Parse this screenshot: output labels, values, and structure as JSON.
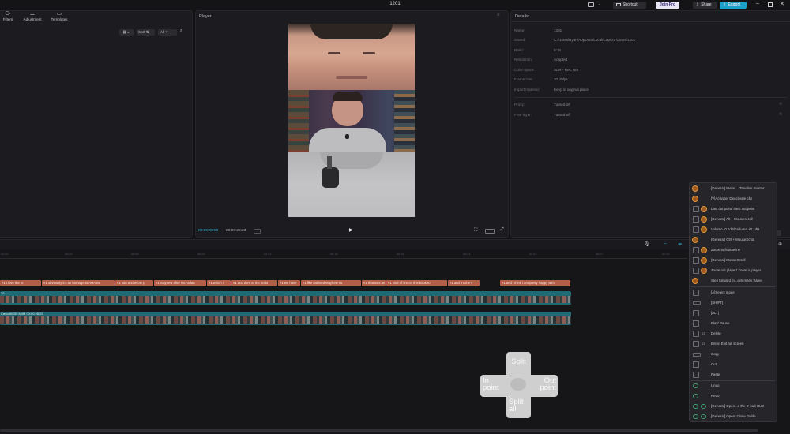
{
  "window": {
    "title": "1201"
  },
  "topbar": {
    "shortcut": "Shortcut",
    "join_pro": "Join Pro",
    "share": "Share",
    "export": "Export"
  },
  "media_tabs": [
    {
      "label": "Filters",
      "icon": "filters-icon"
    },
    {
      "label": "Adjustment",
      "icon": "adjustment-icon"
    },
    {
      "label": "Templates",
      "icon": "templates-icon"
    }
  ],
  "media_toolbar": {
    "sort": "Sort",
    "all": "All"
  },
  "player": {
    "title": "Player",
    "current_time": "00:00:00:00",
    "total_time": "00:00:28:23"
  },
  "details": {
    "title": "Details",
    "rows": [
      {
        "key": "Name:",
        "value": "1201"
      },
      {
        "key": "Saved:",
        "value": "C:/Users/Ryan/AppData/Local/CapCut Drafts/1201"
      },
      {
        "key": "Ratio:",
        "value": "9:16"
      },
      {
        "key": "Resolution:",
        "value": "Adapted"
      },
      {
        "key": "Color space:",
        "value": "SDR - Rec.709"
      },
      {
        "key": "Frame rate:",
        "value": "30.00fps"
      },
      {
        "key": "Import material:",
        "value": "Keep in original place"
      }
    ],
    "rows2": [
      {
        "key": "Proxy:",
        "value": "Turned off"
      },
      {
        "key": "Free layer:",
        "value": "Turned off"
      }
    ],
    "modify": "Modify"
  },
  "timeline": {
    "ruler": [
      "00:00",
      "00:03",
      "00:06",
      "00:09",
      "00:12",
      "00:15",
      "00:18",
      "00:21",
      "00:24",
      "00:27",
      "00:30"
    ],
    "captions": [
      "#1 I love the to",
      "#1 obviously it's an homage to AMA Br",
      "#1 son and wrote p",
      "#1 mayhew after McFarlan",
      "#1 which i",
      "#1 and then at the botto",
      "#1 we have",
      "#1 like outlined Mayhew su",
      "#1 that was an",
      "#1 kind of fire on this book to",
      "#1 and it's the v",
      "#1 and i think i am pretty happy with"
    ],
    "clip1_label": "25",
    "clip2_label": "Casual5259.M4M  00:00:28:25"
  },
  "shortcuts": {
    "group1": [
      "[General] Move ... Timeline Pointer",
      "[V]Activate/ Deactivate clip",
      "Last cut point/ Next cut point",
      "[General] Alt + Mousescroll",
      "Volume -0.1dB/ Volume +0.1dB",
      "[General] Ctrl + MouseScroll",
      "Zoom to fit timeline",
      "[General] MouseScroll",
      "Zoom out player/ Zoom in player",
      "Step forward m...ack many frame"
    ],
    "group2": [
      {
        "x": "",
        "label": "[A]Select mode"
      },
      {
        "x": "",
        "label": "[SHIFT]"
      },
      {
        "x": "",
        "label": "[ALT]"
      },
      {
        "x": "",
        "label": "Play/ Pause"
      },
      {
        "x": "x2",
        "label": "Delete"
      },
      {
        "x": "x2",
        "label": "Enter/ Exit full screen"
      },
      {
        "x": "",
        "label": "Copy"
      },
      {
        "x": "",
        "label": "Cut"
      },
      {
        "x": "",
        "label": "Paste"
      }
    ],
    "group3": [
      "Undo",
      "Redo",
      "[General] Open...e the D-pad HUD",
      "[General] Open/ Close Guide"
    ]
  },
  "dpad": {
    "up": "Split",
    "left": "In point",
    "right": "Out point",
    "down": "Split all"
  }
}
